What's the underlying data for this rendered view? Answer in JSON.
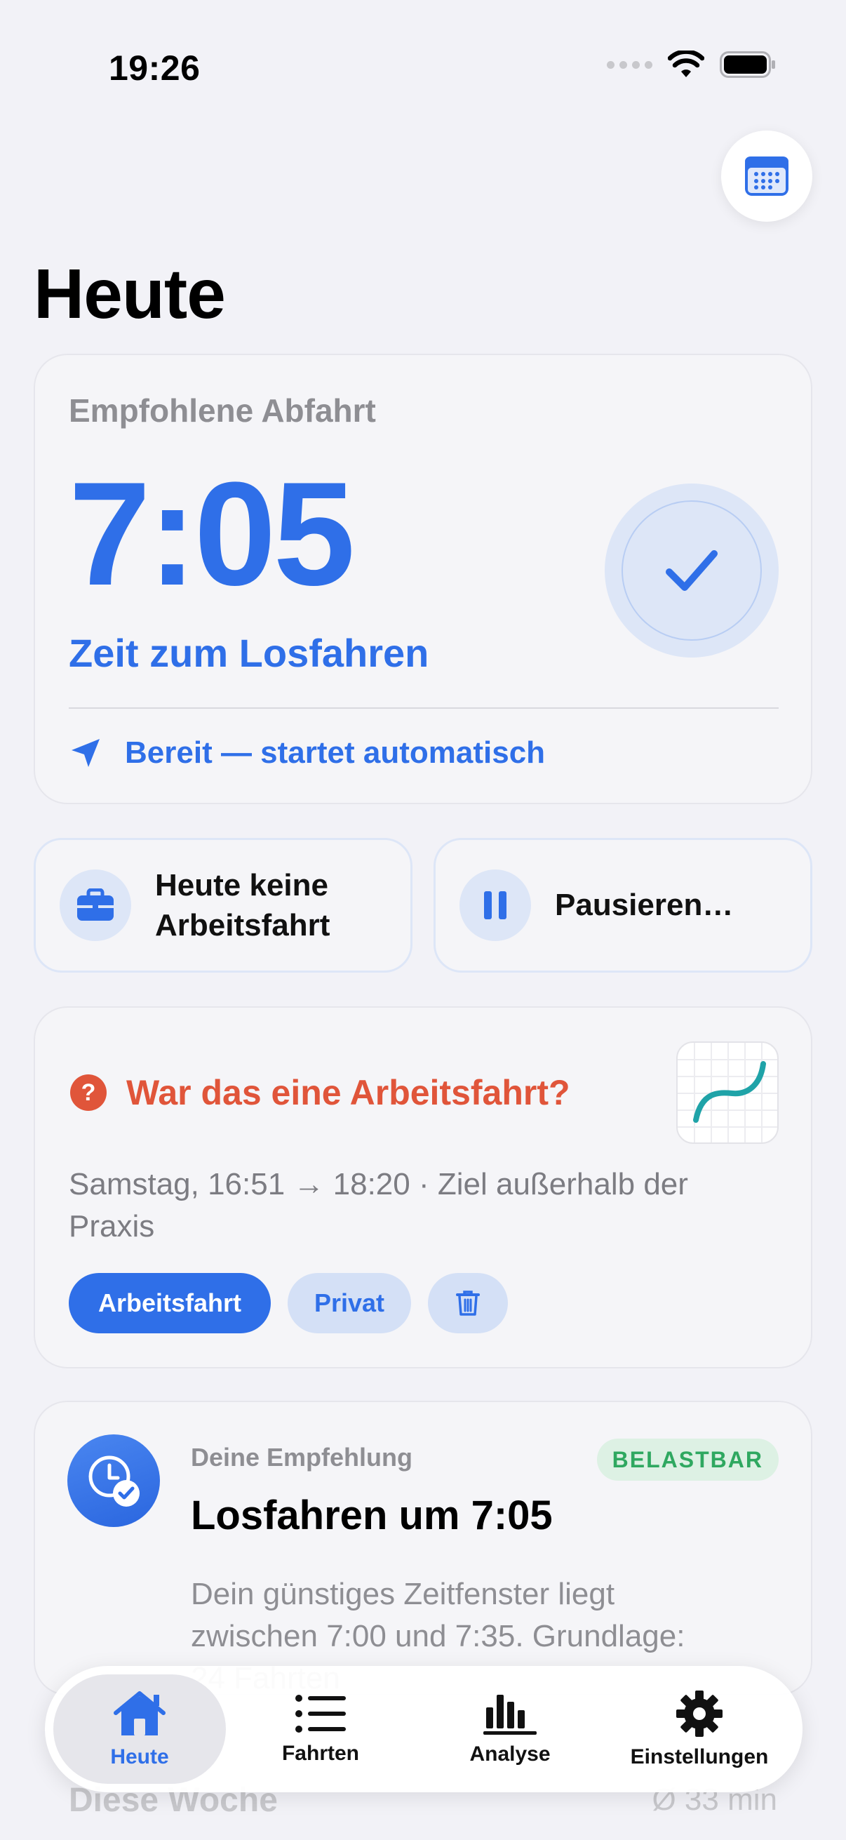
{
  "status_bar": {
    "time": "19:26"
  },
  "header": {
    "title": "Heute"
  },
  "departure": {
    "label": "Empfohlene Abfahrt",
    "time": "7:05",
    "subtitle": "Zeit zum Losfahren",
    "status": "Bereit — startet automatisch"
  },
  "actions": {
    "no_work_trip": "Heute keine Arbeitsfahrt",
    "pause": "Pausieren…"
  },
  "question": {
    "title": "War das eine Arbeitsfahrt?",
    "description": "Samstag, 16:51 → 18:20 · Ziel außerhalb der Praxis",
    "primary_label": "Arbeitsfahrt",
    "secondary_label": "Privat",
    "badge_glyph": "?"
  },
  "recommendation": {
    "kicker": "Deine Empfehlung",
    "tag": "BELASTBAR",
    "title": "Losfahren um 7:05",
    "body": "Dein günstiges Zeitfenster liegt zwischen 7:00 und 7:35. Grundlage: 24 Fahrten"
  },
  "week": {
    "title": "Diese Woche",
    "average": "Ø 33 min"
  },
  "tabs": [
    {
      "label": "Heute",
      "icon": "house-icon",
      "active": true
    },
    {
      "label": "Fahrten",
      "icon": "list-icon",
      "active": false
    },
    {
      "label": "Analyse",
      "icon": "chart-icon",
      "active": false
    },
    {
      "label": "Einstellungen",
      "icon": "gear-icon",
      "active": false
    }
  ],
  "colors": {
    "accent": "#2f6fe8",
    "warning": "#e0553a",
    "success": "#2fa860"
  }
}
